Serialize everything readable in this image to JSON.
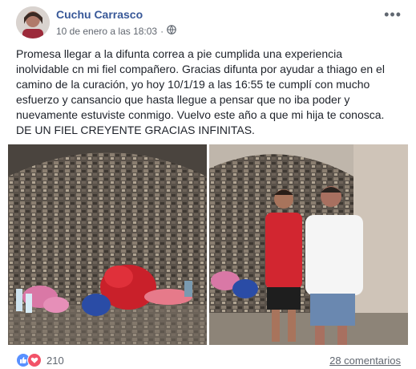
{
  "post": {
    "author": "Cuchu Carrasco",
    "timestamp": "10 de enero a las 18:03",
    "separator": "·",
    "privacy_icon": "globe-icon",
    "more_icon": "more-horizontal-icon",
    "more_label": "•••",
    "text": "Promesa llegar a la difunta correa a pie cumplida una experiencia\ninolvidable cn mi fiel compañero. Gracias difunta por ayudar a thiago en el\ncamino de la curación, yo hoy 10/1/19 a las 16:55 te cumplí con mucho\nesfuerzo y cansancio que hasta llegue a pensar que no iba poder y\nnuevamente estuviste conmigo. Vuelvo este año a que mi hija te conosca.\nDE UN FIEL CREYENTE GRACIAS INFINITAS.",
    "photos": [
      {
        "name": "shrine-offerings-photo"
      },
      {
        "name": "two-men-at-shrine-photo"
      }
    ],
    "reactions": {
      "icons": [
        "like-icon",
        "love-icon"
      ],
      "count": "210"
    },
    "comments_label": "28 comentarios",
    "colors": {
      "author": "#385898",
      "meta": "#616770",
      "like": "#5890ff",
      "love": "#f25268"
    }
  }
}
